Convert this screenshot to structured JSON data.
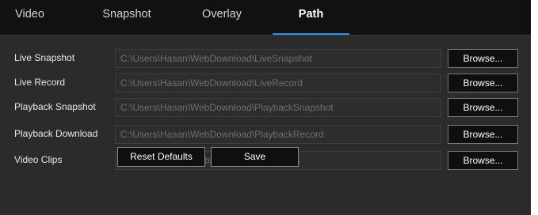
{
  "tabs": [
    {
      "label": "Video",
      "active": false
    },
    {
      "label": "Snapshot",
      "active": false
    },
    {
      "label": "Overlay",
      "active": false
    },
    {
      "label": "Path",
      "active": true
    }
  ],
  "rows": [
    {
      "label": "Live Snapshot",
      "path": "C:\\Users\\Hasan\\WebDownload\\LiveSnapshot",
      "button": "Browse..."
    },
    {
      "label": "Live Record",
      "path": "C:\\Users\\Hasan\\WebDownload\\LiveRecord",
      "button": "Browse..."
    },
    {
      "label": "Playback Snapshot",
      "path": "C:\\Users\\Hasan\\WebDownload\\PlaybackSnapshot",
      "button": "Browse..."
    },
    {
      "label": "Playback Download",
      "path": "C:\\Users\\Hasan\\WebDownload\\PlaybackRecord",
      "button": "Browse..."
    },
    {
      "label": "Video Clips",
      "path": "C:\\Users\\Hasan\\WebDownload\\VideoClips",
      "button": "Browse..."
    }
  ],
  "actions": {
    "reset_label": "Reset Defaults",
    "save_label": "Save"
  },
  "colors": {
    "accent": "#2f8fe6",
    "background": "#2b2b2b",
    "tabbar": "#111111"
  }
}
